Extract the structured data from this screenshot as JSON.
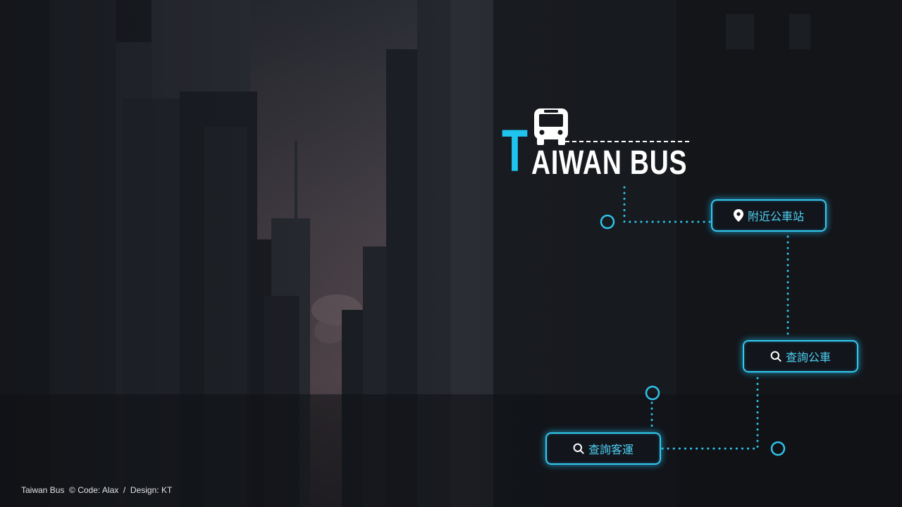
{
  "brand": {
    "logo_initial": "T",
    "logo_rest": "AIWAN BUS",
    "accent_color": "#1fc4ee",
    "logo_icon": "bus-icon"
  },
  "menu": {
    "nearby_stops": {
      "label": "附近公車站",
      "icon": "map-pin-icon"
    },
    "search_bus": {
      "label": "查詢公車",
      "icon": "search-icon"
    },
    "search_coach": {
      "label": "查詢客運",
      "icon": "search-icon"
    }
  },
  "footer": {
    "text": "Taiwan Bus  © Code: Alax  /  Design: KT"
  }
}
